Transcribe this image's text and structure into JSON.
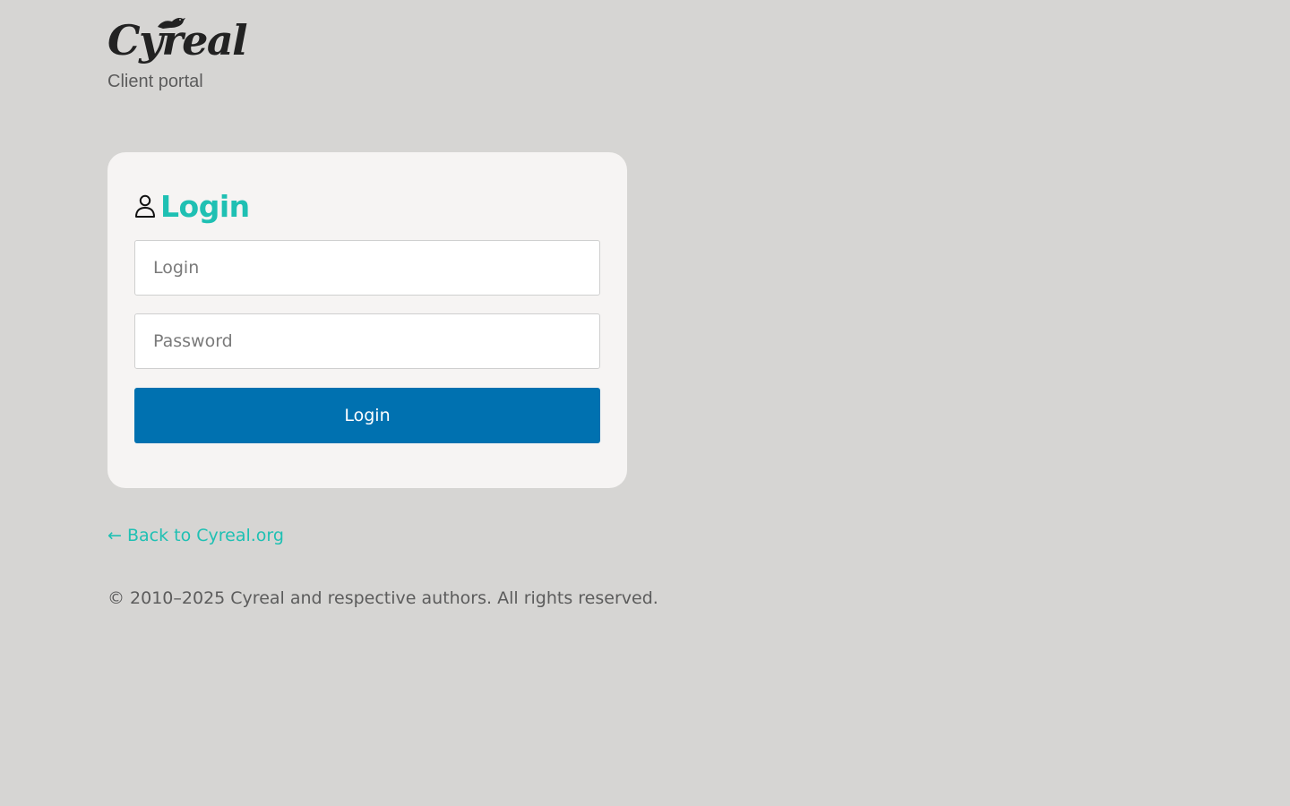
{
  "header": {
    "logo_text": "Cyreal",
    "tagline": "Client portal"
  },
  "login_card": {
    "title": "Login",
    "title_icon": "user-icon",
    "login_field": {
      "placeholder": "Login",
      "value": ""
    },
    "password_field": {
      "placeholder": "Password",
      "value": ""
    },
    "submit_label": "Login"
  },
  "footer": {
    "back_link": "← Back to Cyreal.org",
    "copyright": "© 2010–2025 Cyreal and respective authors. All rights reserved."
  },
  "colors": {
    "background": "#d6d5d3",
    "card": "#f6f4f3",
    "accent": "#1fc0b3",
    "button": "#0071b0"
  }
}
